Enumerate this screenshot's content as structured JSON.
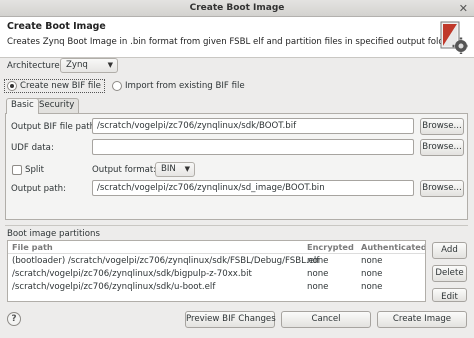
{
  "window": {
    "title": "Create Boot Image"
  },
  "header": {
    "title": "Create Boot Image",
    "description": "Creates Zynq Boot Image in .bin format from given FSBL elf and partition files in specified output folder."
  },
  "architecture": {
    "label": "Architecture:",
    "value": "Zynq"
  },
  "mode": {
    "create_new_label": "Create new BIF file",
    "import_label": "Import from existing BIF file",
    "selected": "create_new"
  },
  "tabs": [
    {
      "label": "Basic",
      "active": true
    },
    {
      "label": "Security",
      "active": false
    }
  ],
  "basic": {
    "bif_path_label": "Output BIF file path:",
    "bif_path_value": "/scratch/vogelpi/zc706/zynqlinux/sdk/BOOT.bif",
    "udf_label": "UDF data:",
    "udf_value": "",
    "split_label": "Split",
    "output_format_label": "Output format:",
    "output_format_value": "BIN",
    "output_path_label": "Output path:",
    "output_path_value": "/scratch/vogelpi/zc706/zynqlinux/sd_image/BOOT.bin",
    "browse_label": "Browse..."
  },
  "partitions": {
    "section_label": "Boot image partitions",
    "columns": [
      "File path",
      "Encrypted",
      "Authenticated"
    ],
    "rows": [
      {
        "path": "(bootloader) /scratch/vogelpi/zc706/zynqlinux/sdk/FSBL/Debug/FSBL.elf",
        "encrypted": "none",
        "authenticated": "none"
      },
      {
        "path": "/scratch/vogelpi/zc706/zynqlinux/sdk/bigpulp-z-70xx.bit",
        "encrypted": "none",
        "authenticated": "none"
      },
      {
        "path": "/scratch/vogelpi/zc706/zynqlinux/sdk/u-boot.elf",
        "encrypted": "none",
        "authenticated": "none"
      }
    ],
    "add_label": "Add",
    "delete_label": "Delete",
    "edit_label": "Edit"
  },
  "footer": {
    "help_label": "?",
    "preview_label": "Preview BIF Changes",
    "cancel_label": "Cancel",
    "create_label": "Create Image"
  },
  "colors": {
    "header_bg": "#ffffff",
    "dialog_bg": "#edeceb",
    "icon_red": "#c0392b"
  },
  "icons": {
    "header": "boot-image-gear-icon",
    "dropdown": "chevron-down-icon",
    "close": "close-icon"
  }
}
